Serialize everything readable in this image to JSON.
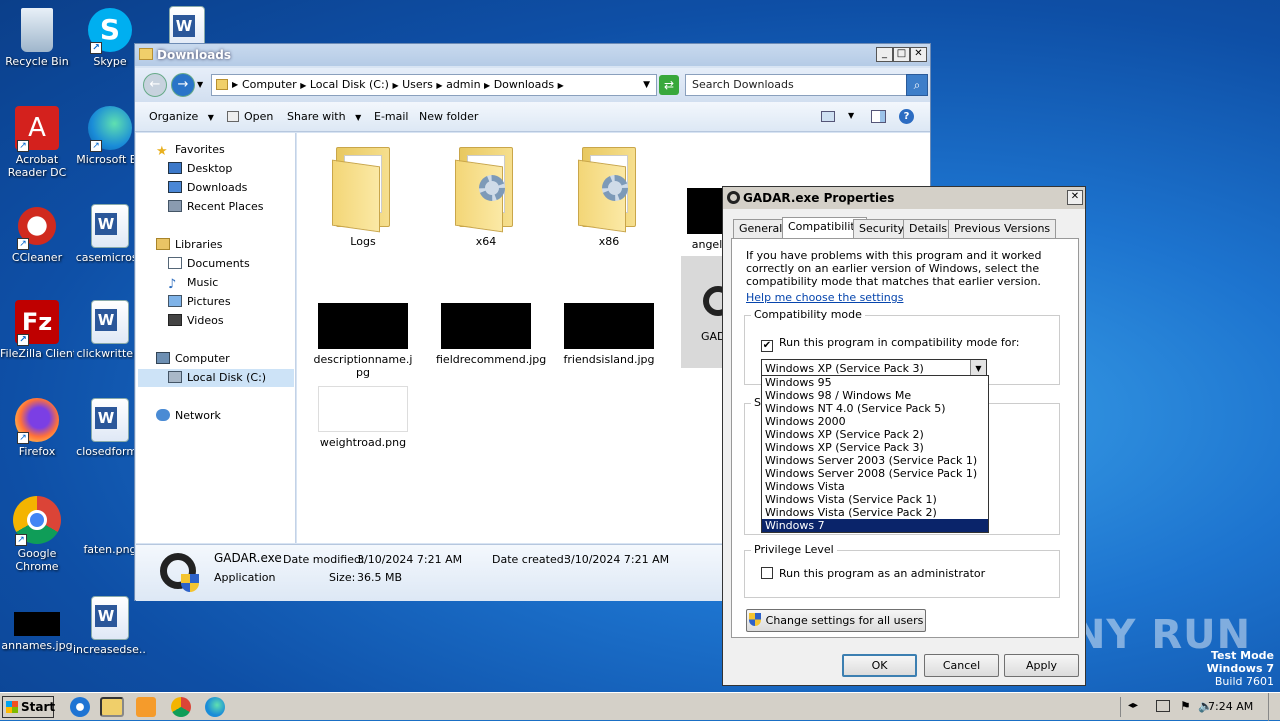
{
  "desktop": {
    "icons": [
      {
        "label": "Recycle Bin"
      },
      {
        "label": "Skype"
      },
      {
        "label": "Acrobat Reader DC"
      },
      {
        "label": "Microsoft Ed"
      },
      {
        "label": "CCleaner"
      },
      {
        "label": "casemicroso"
      },
      {
        "label": "FileZilla Client"
      },
      {
        "label": "clickwritten."
      },
      {
        "label": "Firefox"
      },
      {
        "label": "closedforma"
      },
      {
        "label": "Google Chrome"
      },
      {
        "label": "faten.png"
      },
      {
        "label": "annames.jpg"
      },
      {
        "label": "increasedse..."
      }
    ],
    "watermark": "ANY RUN",
    "test_mode": {
      "line1": "Test Mode",
      "line2": "Windows 7",
      "line3": "Build 7601"
    }
  },
  "explorer": {
    "title": "Downloads",
    "breadcrumb": [
      "Computer",
      "Local Disk (C:)",
      "Users",
      "admin",
      "Downloads"
    ],
    "search_placeholder": "Search Downloads",
    "commands": {
      "organize": "Organize",
      "open": "Open",
      "share_with": "Share with",
      "email": "E-mail",
      "new_folder": "New folder"
    },
    "nav": {
      "favorites": "Favorites",
      "desktop": "Desktop",
      "downloads": "Downloads",
      "recent": "Recent Places",
      "libraries": "Libraries",
      "documents": "Documents",
      "music": "Music",
      "pictures": "Pictures",
      "videos": "Videos",
      "computer": "Computer",
      "local_disk": "Local Disk (C:)",
      "network": "Network"
    },
    "files": [
      {
        "name": "Logs"
      },
      {
        "name": "x64"
      },
      {
        "name": "x86"
      },
      {
        "name": "angel"
      },
      {
        "name": "descriptionname.jpg"
      },
      {
        "name": "fieldrecommend.jpg"
      },
      {
        "name": "friendsisland.jpg"
      },
      {
        "name": "GAD"
      },
      {
        "name": "weightroad.png"
      }
    ],
    "details": {
      "filename": "GADAR.exe",
      "modified_label": "Date modified:",
      "modified": "3/10/2024 7:21 AM",
      "created_label": "Date created:",
      "created": "3/10/2024 7:21 AM",
      "type": "Application",
      "size_label": "Size:",
      "size": "36.5 MB"
    }
  },
  "properties": {
    "title": "GADAR.exe Properties",
    "tabs": [
      "General",
      "Compatibility",
      "Security",
      "Details",
      "Previous Versions"
    ],
    "intro": "If you have problems with this program and it worked correctly on an earlier version of Windows, select the compatibility mode that matches that earlier version.",
    "help_link": "Help me choose the settings",
    "compat_group": "Compatibility mode",
    "compat_check": "Run this program in compatibility mode for:",
    "selected_mode": "Windows XP (Service Pack 3)",
    "options": [
      "Windows 95",
      "Windows 98 / Windows Me",
      "Windows NT 4.0 (Service Pack 5)",
      "Windows 2000",
      "Windows XP (Service Pack 2)",
      "Windows XP (Service Pack 3)",
      "Windows Server 2003 (Service Pack 1)",
      "Windows Server 2008 (Service Pack 1)",
      "Windows Vista",
      "Windows Vista (Service Pack 1)",
      "Windows Vista (Service Pack 2)",
      "Windows 7"
    ],
    "highlighted_option": "Windows 7",
    "settings_group_letter": "S",
    "privilege_group": "Privilege Level",
    "admin_check": "Run this program as an administrator",
    "change_all_users": "Change settings for all users",
    "ok": "OK",
    "cancel": "Cancel",
    "apply": "Apply"
  },
  "taskbar": {
    "start": "Start",
    "clock": "7:24 AM"
  }
}
